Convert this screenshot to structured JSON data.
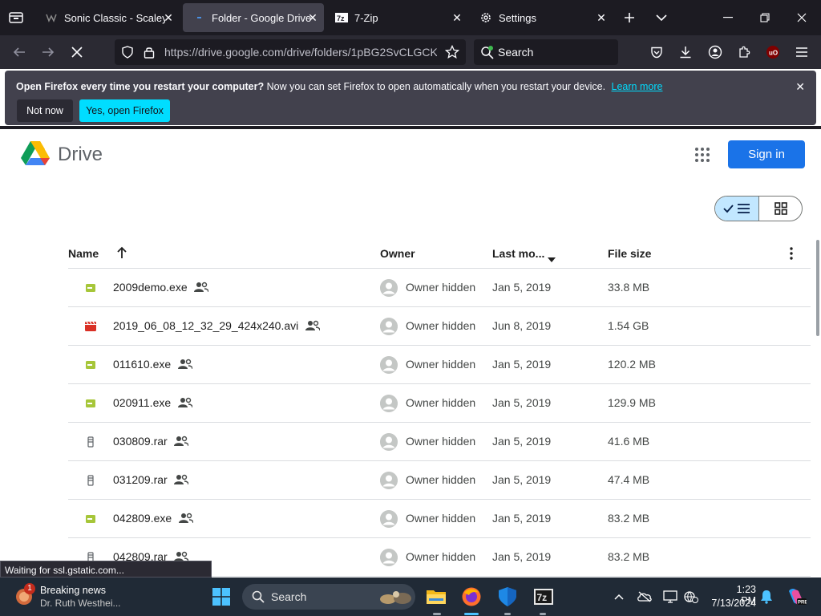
{
  "browser": {
    "tabs": [
      {
        "label": "Sonic Classic - ScaleyFi",
        "active": false
      },
      {
        "label": "Folder - Google Drive",
        "active": true
      },
      {
        "label": "7-Zip",
        "active": false
      },
      {
        "label": "Settings",
        "active": false
      }
    ],
    "url": "https://drive.google.com/drive/folders/1pBG2SvCLGCK",
    "search_placeholder": "Search"
  },
  "notification": {
    "bold": "Open Firefox every time you restart your computer?",
    "text": "Now you can set Firefox to open automatically when you restart your device.",
    "link": "Learn more",
    "not_now": "Not now",
    "yes": "Yes, open Firefox"
  },
  "drive": {
    "title": "Drive",
    "sign_in": "Sign in",
    "columns": {
      "name": "Name",
      "owner": "Owner",
      "modified": "Last mo...",
      "size": "File size"
    },
    "files": [
      {
        "name": "2009demo.exe",
        "type": "exe",
        "owner": "Owner hidden",
        "modified": "Jan 5, 2019",
        "size": "33.8 MB"
      },
      {
        "name": "2019_06_08_12_32_29_424x240.avi",
        "type": "video",
        "owner": "Owner hidden",
        "modified": "Jun 8, 2019",
        "size": "1.54 GB"
      },
      {
        "name": "011610.exe",
        "type": "exe",
        "owner": "Owner hidden",
        "modified": "Jan 5, 2019",
        "size": "120.2 MB"
      },
      {
        "name": "020911.exe",
        "type": "exe",
        "owner": "Owner hidden",
        "modified": "Jan 5, 2019",
        "size": "129.9 MB"
      },
      {
        "name": "030809.rar",
        "type": "archive",
        "owner": "Owner hidden",
        "modified": "Jan 5, 2019",
        "size": "41.6 MB"
      },
      {
        "name": "031209.rar",
        "type": "archive",
        "owner": "Owner hidden",
        "modified": "Jan 5, 2019",
        "size": "47.4 MB"
      },
      {
        "name": "042809.exe",
        "type": "exe",
        "owner": "Owner hidden",
        "modified": "Jan 5, 2019",
        "size": "83.2 MB"
      },
      {
        "name": "042809.rar",
        "type": "archive",
        "owner": "Owner hidden",
        "modified": "Jan 5, 2019",
        "size": "83.2 MB"
      }
    ]
  },
  "status_text": "Waiting for ssl.gstatic.com...",
  "taskbar": {
    "news_title": "Breaking news",
    "news_sub": "Dr. Ruth Westhei...",
    "news_badge": "1",
    "search": "Search",
    "time": "1:23 PM",
    "date": "7/13/2024"
  },
  "colors": {
    "accent": "#1a73e8",
    "firefox_cyan": "#00ddff",
    "exe_icon": "#a6c639",
    "video_icon": "#d93025",
    "archive_icon": "#5f6368"
  }
}
